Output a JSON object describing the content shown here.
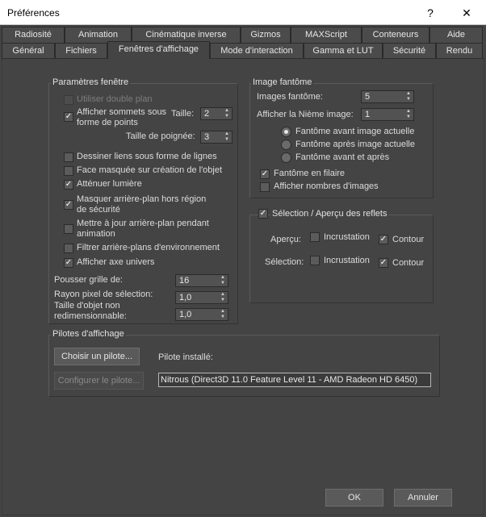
{
  "window": {
    "title": "Préférences",
    "help_glyph": "?",
    "close_glyph": "✕"
  },
  "tabs_top": [
    "Radiosité",
    "Animation",
    "Cinématique inverse",
    "Gizmos",
    "MAXScript",
    "Conteneurs",
    "Aide"
  ],
  "tabs_bottom": [
    "Général",
    "Fichiers",
    "Fenêtres d'affichage",
    "Mode d'interaction",
    "Gamma et LUT",
    "Sécurité",
    "Rendu"
  ],
  "active_tab": "Fenêtres d'affichage",
  "params": {
    "legend": "Paramètres fenêtre",
    "double_plan": "Utiliser double plan",
    "show_vertices_1": "Afficher sommets sous",
    "show_vertices_2": "forme de points",
    "size_label": "Taille:",
    "size_value": "2",
    "handle_label": "Taille de poignée:",
    "handle_value": "3",
    "draw_links": "Dessiner liens sous forme de lignes",
    "backface": "Face masquée sur création de l'objet",
    "attenuate": "Atténuer lumière",
    "mask_bg_1": "Masquer arrière-plan hors région",
    "mask_bg_2": "de sécurité",
    "update_bg_1": "Mettre à jour arrière-plan pendant",
    "update_bg_2": "animation",
    "filter_env": "Filtrer arrière-plans d'environnement",
    "show_axis": "Afficher axe univers",
    "grid_nudge_label": "Pousser grille de:",
    "grid_nudge_value": "16",
    "pick_radius_label": "Rayon pixel de sélection:",
    "pick_radius_value": "1,0",
    "nonscale_label_1": "Taille d'objet non",
    "nonscale_label_2": "redimensionnable:",
    "nonscale_value": "1,0",
    "checked": {
      "double_plan": false,
      "show_vertices": true,
      "draw_links": false,
      "backface": false,
      "attenuate": true,
      "mask_bg": true,
      "update_bg": false,
      "filter_env": false,
      "show_axis": true
    }
  },
  "ghost": {
    "legend": "Image fantôme",
    "frames_label": "Images fantôme:",
    "frames_value": "5",
    "nth_label": "Afficher la Nième image:",
    "nth_value": "1",
    "radio_before": "Fantôme avant image actuelle",
    "radio_after": "Fantôme après image actuelle",
    "radio_both": "Fantôme avant et après",
    "selected_radio": "before",
    "wireframe": "Fantôme en filaire",
    "show_numbers": "Afficher nombres d'images",
    "checked": {
      "wireframe": true,
      "show_numbers": false
    }
  },
  "reflect": {
    "legend": "Sélection / Aperçu des reflets",
    "enabled": true,
    "preview_label": "Aperçu:",
    "selection_label": "Sélection:",
    "inlay": "Incrustation",
    "outline": "Contour",
    "checked": {
      "preview_inlay": false,
      "preview_outline": true,
      "sel_inlay": false,
      "sel_outline": true
    }
  },
  "drivers": {
    "legend": "Pilotes d'affichage",
    "choose_button": "Choisir un pilote...",
    "configure_button": "Configurer le pilote...",
    "installed_label": "Pilote installé:",
    "installed_value": "Nitrous (Direct3D 11.0 Feature Level 11 - AMD Radeon HD 6450)"
  },
  "footer": {
    "ok": "OK",
    "cancel": "Annuler"
  },
  "glyphs": {
    "check": "✓",
    "spin_up": "▲",
    "spin_down": "▼"
  }
}
